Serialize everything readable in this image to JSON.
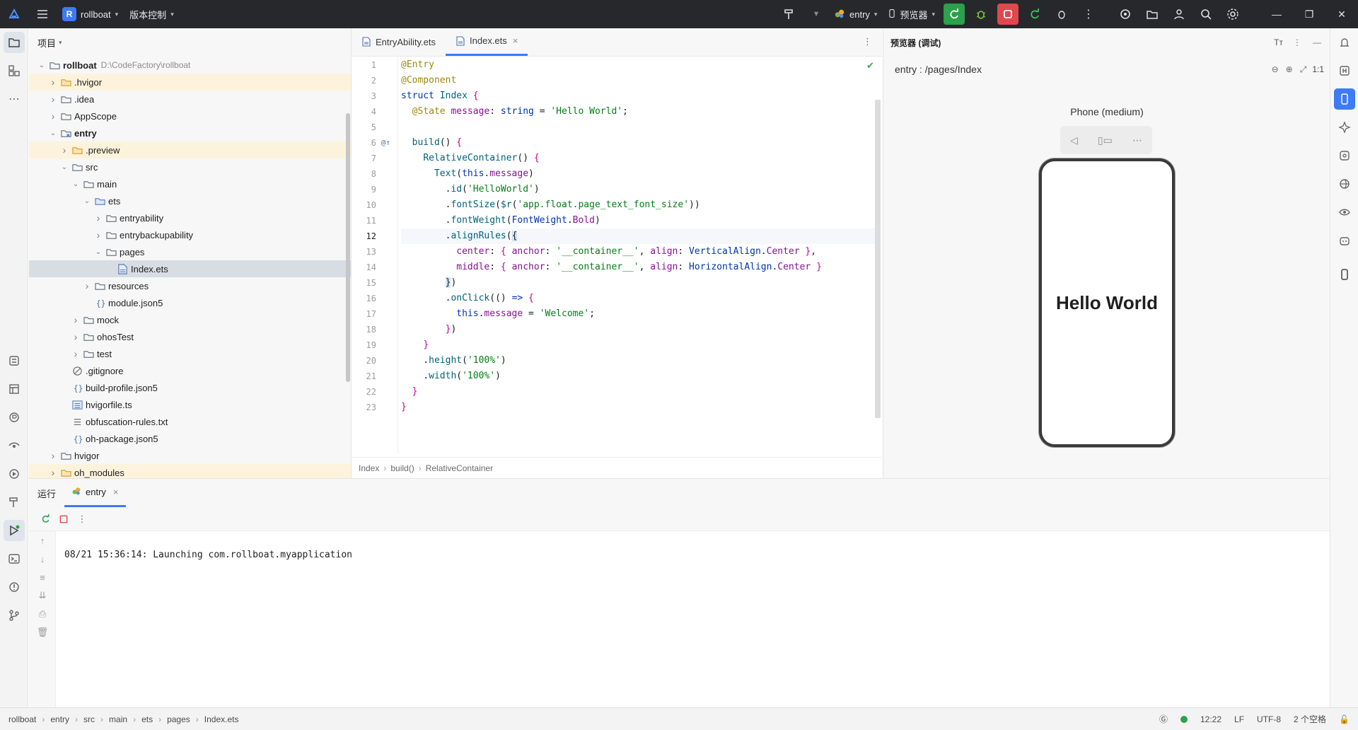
{
  "titlebar": {
    "project_badge": "R",
    "project_name": "rollboat",
    "vcs_label": "版本控制",
    "run_config": "entry",
    "device": "预览器"
  },
  "project_panel": {
    "title": "项目",
    "root_name": "rollboat",
    "root_path": "D:\\CodeFactory\\rollboat",
    "tree": [
      {
        "label": "rollboat",
        "depth": 0,
        "kind": "folder",
        "expanded": true
      },
      {
        "label": ".hvigor",
        "depth": 1,
        "kind": "folder-orange",
        "expanded": false
      },
      {
        "label": ".idea",
        "depth": 1,
        "kind": "folder",
        "expanded": false
      },
      {
        "label": "AppScope",
        "depth": 1,
        "kind": "folder",
        "expanded": false
      },
      {
        "label": "entry",
        "depth": 1,
        "kind": "folder-module",
        "expanded": true
      },
      {
        "label": ".preview",
        "depth": 2,
        "kind": "folder-orange",
        "expanded": false
      },
      {
        "label": "src",
        "depth": 2,
        "kind": "folder",
        "expanded": true
      },
      {
        "label": "main",
        "depth": 3,
        "kind": "folder",
        "expanded": true
      },
      {
        "label": "ets",
        "depth": 4,
        "kind": "folder-blue",
        "expanded": true
      },
      {
        "label": "entryability",
        "depth": 5,
        "kind": "folder",
        "expanded": false
      },
      {
        "label": "entrybackupability",
        "depth": 5,
        "kind": "folder",
        "expanded": false
      },
      {
        "label": "pages",
        "depth": 5,
        "kind": "folder",
        "expanded": true
      },
      {
        "label": "Index.ets",
        "depth": 6,
        "kind": "ets",
        "expanded": null
      },
      {
        "label": "resources",
        "depth": 4,
        "kind": "folder",
        "expanded": false
      },
      {
        "label": "module.json5",
        "depth": 4,
        "kind": "json",
        "expanded": null
      },
      {
        "label": "mock",
        "depth": 3,
        "kind": "folder",
        "expanded": false
      },
      {
        "label": "ohosTest",
        "depth": 3,
        "kind": "folder",
        "expanded": false
      },
      {
        "label": "test",
        "depth": 3,
        "kind": "folder",
        "expanded": false
      },
      {
        "label": ".gitignore",
        "depth": 2,
        "kind": "ignore",
        "expanded": null
      },
      {
        "label": "build-profile.json5",
        "depth": 2,
        "kind": "json",
        "expanded": null
      },
      {
        "label": "hvigorfile.ts",
        "depth": 2,
        "kind": "ts",
        "expanded": null
      },
      {
        "label": "obfuscation-rules.txt",
        "depth": 2,
        "kind": "txt",
        "expanded": null
      },
      {
        "label": "oh-package.json5",
        "depth": 2,
        "kind": "json",
        "expanded": null
      },
      {
        "label": "hvigor",
        "depth": 1,
        "kind": "folder",
        "expanded": false
      },
      {
        "label": "oh_modules",
        "depth": 1,
        "kind": "folder-orange",
        "expanded": false
      }
    ]
  },
  "editor": {
    "tabs": [
      {
        "label": "EntryAbility.ets",
        "active": false
      },
      {
        "label": "Index.ets",
        "active": true
      }
    ],
    "current_line": 12,
    "breadcrumb": [
      "Index",
      "build()",
      "RelativeContainer"
    ]
  },
  "preview": {
    "title": "预览器 (调试)",
    "url": "entry : /pages/Index",
    "zoom": "1:1",
    "device_label": "Phone (medium)",
    "screen_text": "Hello World"
  },
  "run_panel": {
    "title": "运行",
    "tab_label": "entry",
    "console_line": "08/21 15:36:14: Launching com.rollboat.myapplication"
  },
  "statusbar": {
    "path": [
      "rollboat",
      "entry",
      "src",
      "main",
      "ets",
      "pages",
      "Index.ets"
    ],
    "position": "12:22",
    "line_sep": "LF",
    "encoding": "UTF-8",
    "indent": "2 个空格"
  }
}
